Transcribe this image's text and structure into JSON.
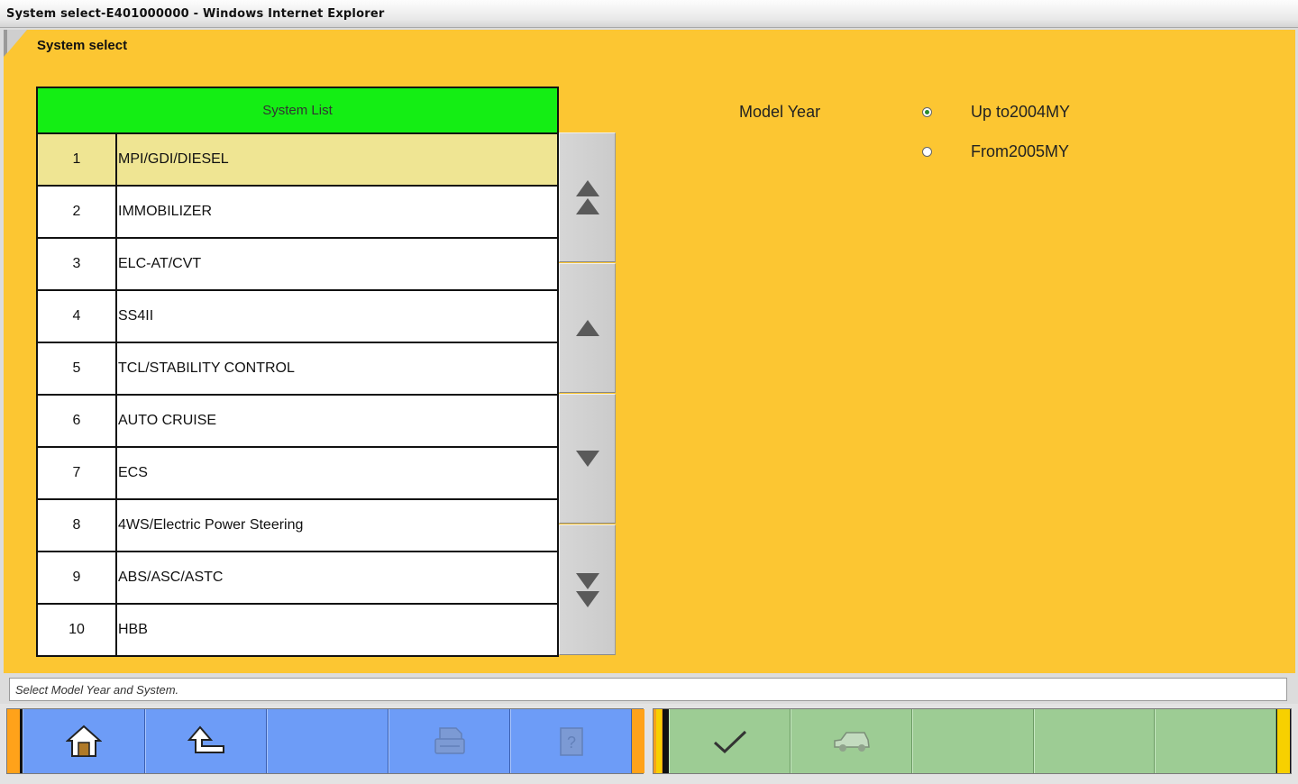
{
  "window": {
    "title": "System select-E401000000 - Windows Internet Explorer"
  },
  "page": {
    "title": "System select"
  },
  "system_list": {
    "header": "System List",
    "selected_index": 0,
    "rows": [
      {
        "num": "1",
        "name": "MPI/GDI/DIESEL"
      },
      {
        "num": "2",
        "name": "IMMOBILIZER"
      },
      {
        "num": "3",
        "name": "ELC-AT/CVT"
      },
      {
        "num": "4",
        "name": "SS4II"
      },
      {
        "num": "5",
        "name": "TCL/STABILITY CONTROL"
      },
      {
        "num": "6",
        "name": "AUTO CRUISE"
      },
      {
        "num": "7",
        "name": "ECS"
      },
      {
        "num": "8",
        "name": "4WS/Electric Power Steering"
      },
      {
        "num": "9",
        "name": "ABS/ASC/ASTC"
      },
      {
        "num": "10",
        "name": "HBB"
      }
    ]
  },
  "model_year": {
    "label": "Model Year",
    "options": [
      {
        "label": "Up to2004MY",
        "checked": true
      },
      {
        "label": "From2005MY",
        "checked": false
      }
    ]
  },
  "status_bar": {
    "message": "Select Model Year and System."
  },
  "toolbar": {
    "left_buttons": [
      {
        "icon": "home-icon",
        "enabled": true
      },
      {
        "icon": "back-up-arrow-icon",
        "enabled": true
      },
      {
        "icon": "empty",
        "enabled": false
      },
      {
        "icon": "printer-icon",
        "enabled": false
      },
      {
        "icon": "help-icon",
        "enabled": false
      }
    ],
    "right_buttons": [
      {
        "icon": "checkmark-icon",
        "enabled": true
      },
      {
        "icon": "vehicle-icon",
        "enabled": false
      },
      {
        "icon": "empty",
        "enabled": false
      },
      {
        "icon": "empty",
        "enabled": false
      },
      {
        "icon": "empty",
        "enabled": false
      }
    ]
  },
  "colors": {
    "background": "#fcc632",
    "list_header": "#14ee14",
    "selected_row": "#efe593",
    "toolbar_blue": "#6d9cf7",
    "toolbar_green": "#9dcc94"
  }
}
